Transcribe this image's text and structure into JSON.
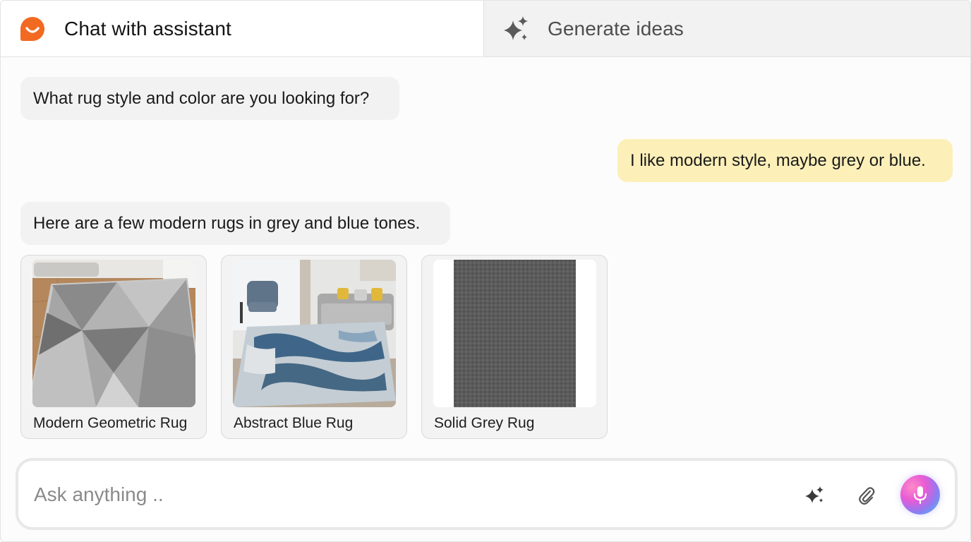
{
  "tabs": [
    {
      "label": "Chat with assistant",
      "icon": "brand-smile-icon",
      "active": true
    },
    {
      "label": "Generate ideas",
      "icon": "sparkle-icon",
      "active": false
    }
  ],
  "messages": [
    {
      "role": "assistant",
      "text": "What rug style and color are you looking for?"
    },
    {
      "role": "user",
      "text": "I like modern style, maybe grey or blue."
    },
    {
      "role": "assistant",
      "text": "Here are a few modern rugs in grey and blue tones."
    }
  ],
  "products": [
    {
      "name": "Modern Geometric Rug"
    },
    {
      "name": "Abstract Blue Rug"
    },
    {
      "name": "Solid Grey Rug"
    }
  ],
  "input": {
    "value": "",
    "placeholder": "Ask anything .."
  },
  "colors": {
    "brand": "#f26a21",
    "user_bubble": "#fcefb8",
    "assistant_bubble": "#f2f2f2"
  }
}
